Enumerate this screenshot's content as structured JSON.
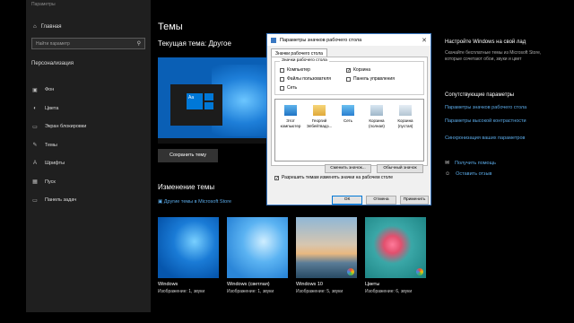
{
  "window_title": "Параметры",
  "sidebar": {
    "home_label": "Главная",
    "search_placeholder": "Найти параметр",
    "section": "Персонализация",
    "items": [
      {
        "label": "Фон",
        "icon": "picture-icon"
      },
      {
        "label": "Цвета",
        "icon": "palette-icon"
      },
      {
        "label": "Экран блокировки",
        "icon": "lock-screen-icon"
      },
      {
        "label": "Темы",
        "icon": "brush-icon"
      },
      {
        "label": "Шрифты",
        "icon": "font-icon"
      },
      {
        "label": "Пуск",
        "icon": "start-icon"
      },
      {
        "label": "Панель задач",
        "icon": "taskbar-icon"
      }
    ]
  },
  "main": {
    "title": "Темы",
    "current_theme": "Текущая тема: Другое",
    "save_button": "Сохранить тему",
    "change_title": "Изменение темы",
    "store_link": "Другие темы в Microsoft Store",
    "themes": [
      {
        "name": "Windows",
        "meta": "Изображение: 1, звуки"
      },
      {
        "name": "Windows (светлая)",
        "meta": "Изображение: 1, звуки"
      },
      {
        "name": "Windows 10",
        "meta": "Изображение: 5, звуки"
      },
      {
        "name": "Цветы",
        "meta": "Изображение: 6, звуки"
      }
    ]
  },
  "right": {
    "title": "Настройте Windows на свой лад",
    "text": "Скачайте бесплатные темы из Microsoft Store, которые сочетают обои, звуки и цвет",
    "related_title": "Сопутствующие параметры",
    "links": [
      "Параметры значков рабочего стола",
      "Параметры высокой контрастности",
      "Синхронизация ваших параметров"
    ],
    "help": "Получить помощь",
    "feedback": "Оставить отзыв"
  },
  "dialog": {
    "title": "Параметры значков рабочего стола",
    "tab": "Значки рабочего стола",
    "group_label": "Значки рабочего стола",
    "checkboxes": [
      {
        "label": "Компьютер",
        "checked": false
      },
      {
        "label": "Корзина",
        "checked": true
      },
      {
        "label": "Файлы пользователя",
        "checked": false
      },
      {
        "label": "Панель управления",
        "checked": false
      },
      {
        "label": "Сеть",
        "checked": false
      }
    ],
    "icons": [
      {
        "label": "Этот компьютер"
      },
      {
        "label": "Георгий Элбейтвадз..."
      },
      {
        "label": "Сеть"
      },
      {
        "label": "Корзина (полная)"
      },
      {
        "label": "Корзина (пустая)"
      }
    ],
    "change_icon": "Сменить значок...",
    "default_icon": "Обычный значок",
    "allow_themes": "Разрешить темам изменять значки на рабочем столе",
    "ok": "ОК",
    "cancel": "Отмена",
    "apply": "Применить"
  }
}
